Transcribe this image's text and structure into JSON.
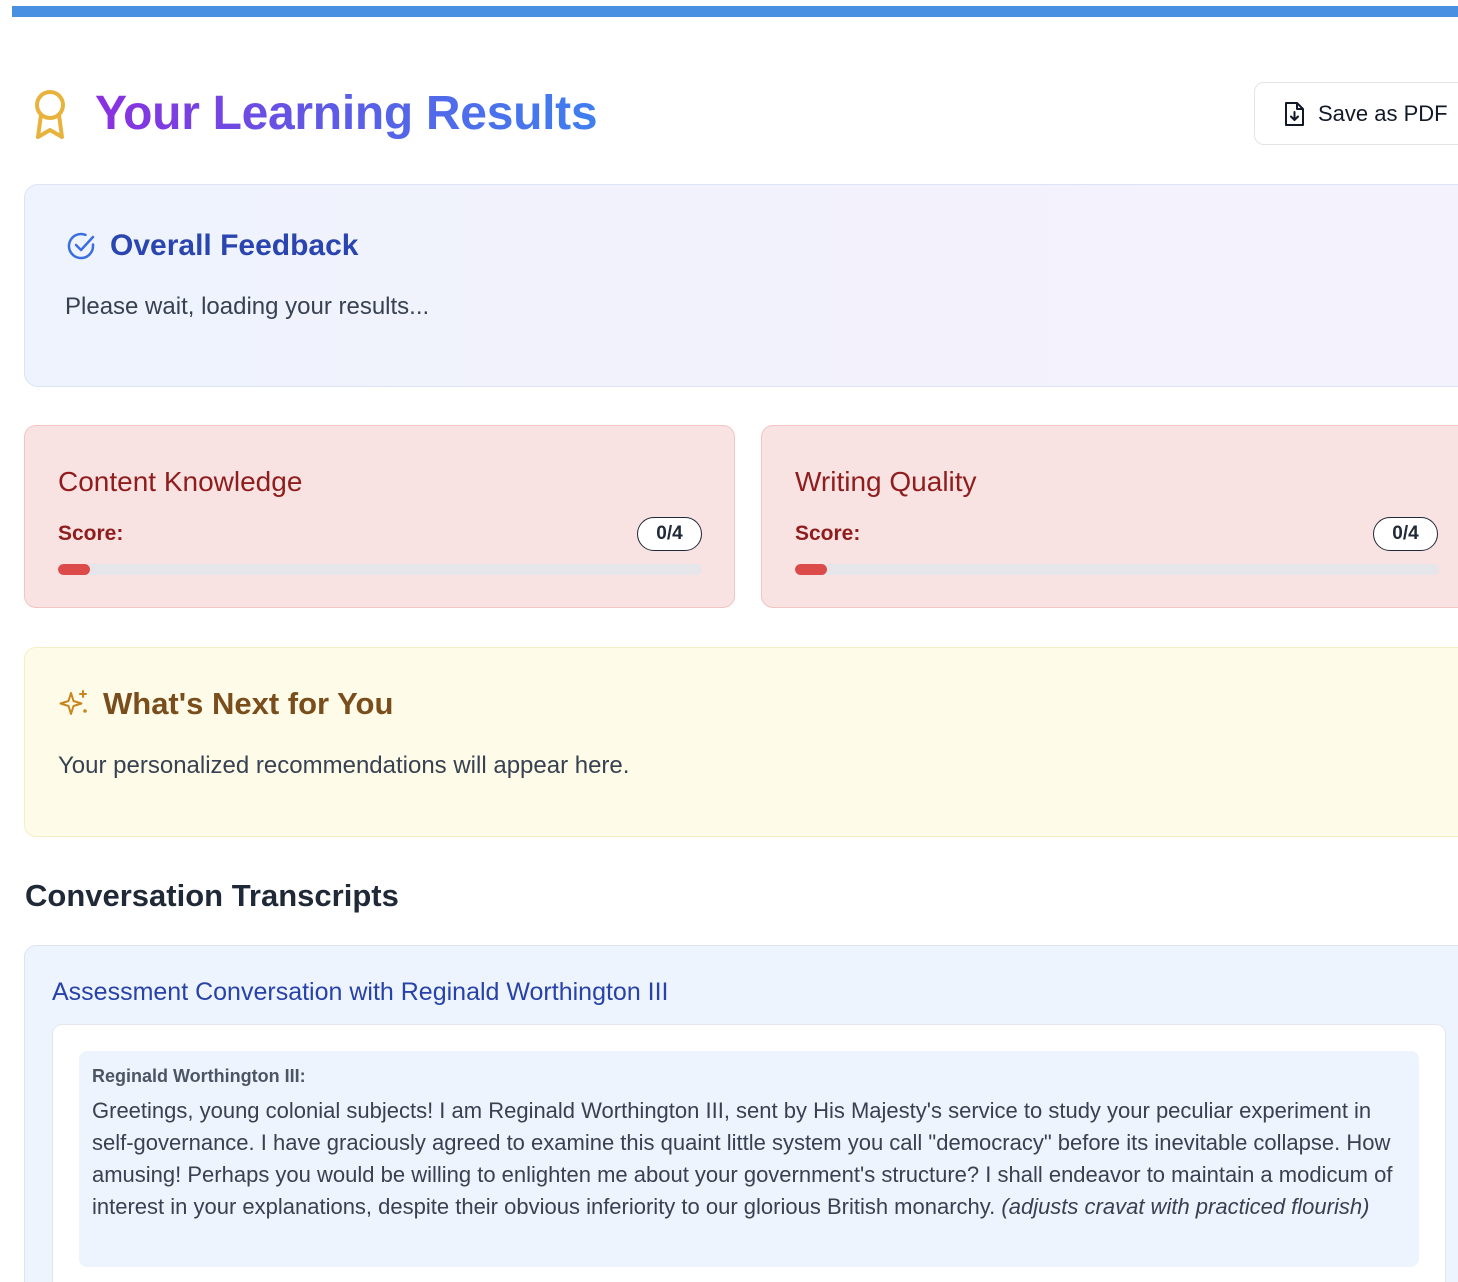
{
  "header": {
    "title": "Your Learning Results",
    "pdf_button_label": "Save as PDF"
  },
  "overall": {
    "title": "Overall Feedback",
    "text": "Please wait, loading your results..."
  },
  "scores": [
    {
      "title": "Content Knowledge",
      "label": "Score:",
      "badge": "0/4",
      "progress_fraction": 0.05
    },
    {
      "title": "Writing Quality",
      "label": "Score:",
      "badge": "0/4",
      "progress_fraction": 0.05
    }
  ],
  "next": {
    "title": "What's Next for You",
    "text": "Your personalized recommendations will appear here."
  },
  "transcripts": {
    "section_title": "Conversation Transcripts",
    "conversation_title": "Assessment Conversation with Reginald Worthington III",
    "messages": [
      {
        "speaker": "Reginald Worthington III:",
        "text": "Greetings, young colonial subjects! I am Reginald Worthington III, sent by His Majesty's service to study your peculiar experiment in self-governance. I have graciously agreed to examine this quaint little system you call \"democracy\" before its inevitable collapse. How amusing! Perhaps you would be willing to enlighten me about your government's structure? I shall endeavor to maintain a modicum of interest in your explanations, despite their obvious inferiority to our glorious British monarchy.",
        "action": "(adjusts cravat with practiced flourish)"
      }
    ]
  },
  "colors": {
    "accent_blue": "#4a90e2",
    "score_bar": "#dc4a4a",
    "feedback_title": "#2a45b0",
    "score_title": "#8f1d1d",
    "next_title": "#7a4e1c"
  },
  "icons": {
    "title": "award-icon",
    "pdf": "file-download-icon",
    "overall": "check-circle-icon",
    "next": "sparkles-icon"
  }
}
